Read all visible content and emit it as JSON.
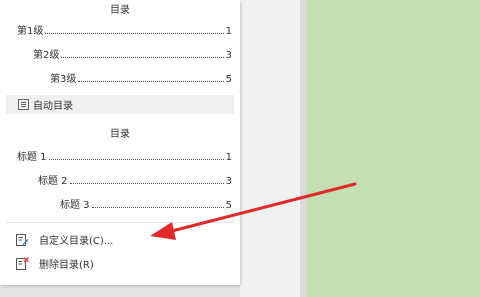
{
  "template1": {
    "title": "目录",
    "rows": [
      {
        "label": "第1级",
        "page": "1"
      },
      {
        "label": "第2级",
        "page": "3"
      },
      {
        "label": "第3级",
        "page": "5"
      }
    ]
  },
  "auto_toc_label": "自动目录",
  "template2": {
    "title": "目录",
    "rows": [
      {
        "label": "标题 1",
        "page": "1"
      },
      {
        "label": "标题 2",
        "page": "3"
      },
      {
        "label": "标题 3",
        "page": "5"
      }
    ]
  },
  "actions": {
    "custom_toc": "自定义目录(C)...",
    "delete_toc": "删除目录(R)"
  },
  "colors": {
    "page_green": "#c4e0b2",
    "arrow_red": "#e02a2a",
    "delete_icon_red": "#e04040"
  }
}
